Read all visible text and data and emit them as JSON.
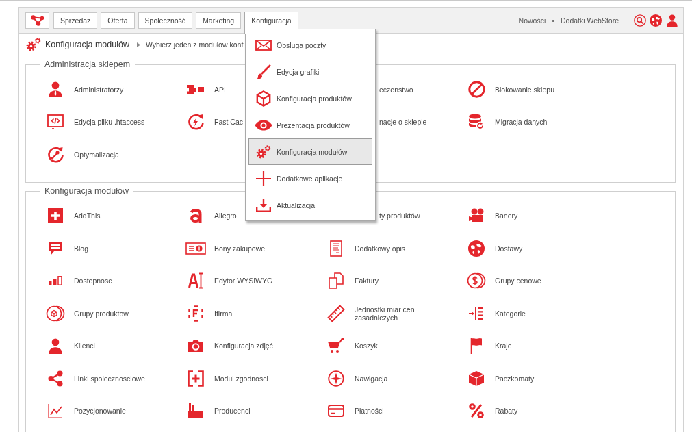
{
  "nav": {
    "tabs": [
      {
        "label": "Sprzedaż",
        "selected": false
      },
      {
        "label": "Oferta",
        "selected": false
      },
      {
        "label": "Społeczność",
        "selected": false
      },
      {
        "label": "Marketing",
        "selected": false
      },
      {
        "label": "Konfiguracja",
        "selected": true
      }
    ],
    "links": [
      "Nowości",
      "Dodatki WebStore"
    ],
    "link_separator": "•"
  },
  "dropdown": {
    "items": [
      {
        "label": "Obsluga poczty",
        "selected": false
      },
      {
        "label": "Edycja grafiki",
        "selected": false
      },
      {
        "label": "Konfiguracja produktów",
        "selected": false
      },
      {
        "label": "Prezentacja produktów",
        "selected": false
      },
      {
        "label": "Konfiguracja modułów",
        "selected": true
      },
      {
        "label": "Dodatkowe aplikacje",
        "selected": false
      },
      {
        "label": "Aktualizacja",
        "selected": false
      }
    ]
  },
  "breadcrumb": {
    "title": "Konfiguracja modułów",
    "subtitle": "Wybierz jeden z modułów konf"
  },
  "sections": [
    {
      "title": "Administracja sklepem",
      "items": [
        "Administratorzy",
        "API",
        "eczenstwo",
        "Blokowanie sklepu",
        "Edycja pliku .htaccess",
        "Fast Cac",
        "nacje o sklepie",
        "Migracja danych",
        "Optymalizacja"
      ]
    },
    {
      "title": "Konfiguracja modułów",
      "items": [
        "AddThis",
        "Allegro",
        "ty produktów",
        "Banery",
        "Blog",
        "Bony zakupowe",
        "Dodatkowy opis",
        "Dostawy",
        "Dostepnosc",
        "Edytor WYSIWYG",
        "Faktury",
        "Grupy cenowe",
        "Grupy produktow",
        "Ifirma",
        "Jednostki miar cen zasadniczych",
        "Kategorie",
        "Klienci",
        "Konfiguracja zdjęć",
        "Koszyk",
        "Kraje",
        "Linki spolecznosciowe",
        "Modul zgodnosci",
        "Nawigacja",
        "Paczkomaty",
        "Pozycjonowanie",
        "Producenci",
        "Płatności",
        "Rabaty"
      ]
    }
  ]
}
